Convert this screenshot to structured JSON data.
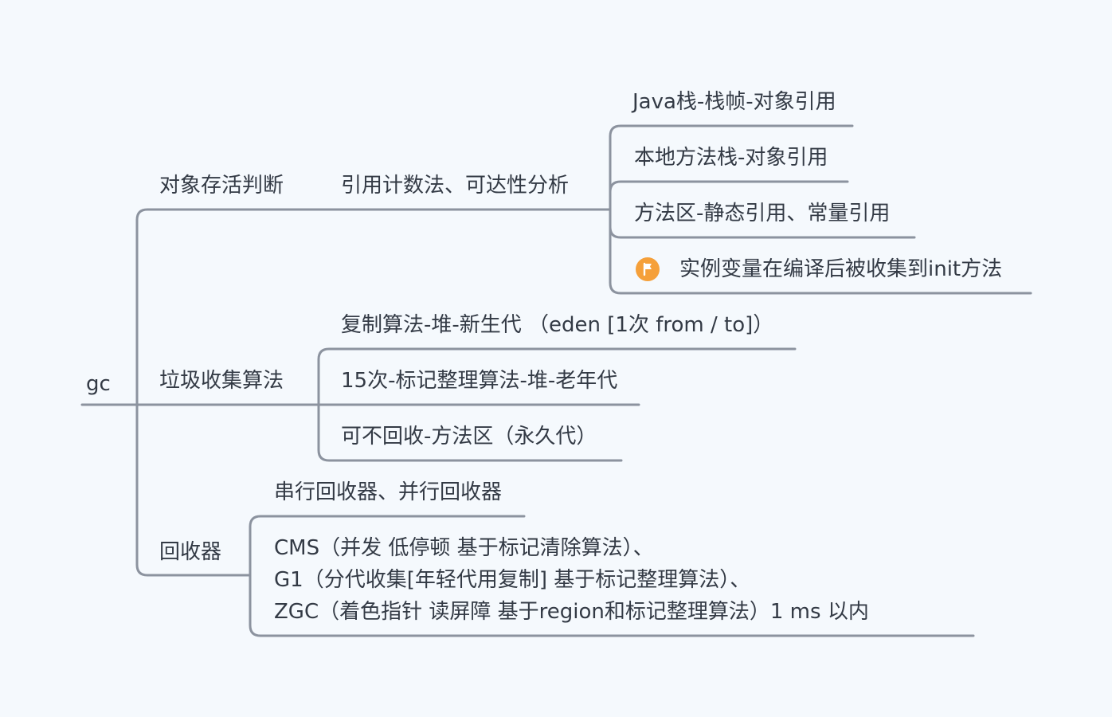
{
  "root": {
    "label": "gc"
  },
  "branches": [
    {
      "label": "对象存活判断",
      "children": [
        {
          "label": "引用计数法、可达性分析",
          "children": [
            {
              "label": "Java栈-栈帧-对象引用"
            },
            {
              "label": "本地方法栈-对象引用"
            },
            {
              "label": "方法区-静态引用、常量引用"
            },
            {
              "label": "实例变量在编译后被收集到init方法",
              "marker": "flag-icon",
              "marker_color": "#f5a03a"
            }
          ]
        }
      ]
    },
    {
      "label": "垃圾收集算法",
      "children": [
        {
          "label": "复制算法-堆-新生代 （eden [1次 from / to]）"
        },
        {
          "label": "15次-标记整理算法-堆-老年代"
        },
        {
          "label": "可不回收-方法区（永久代）"
        }
      ]
    },
    {
      "label": "回收器",
      "children": [
        {
          "label": "串行回收器、并行回收器"
        },
        {
          "lines": [
            "CMS（并发 低停顿 基于标记清除算法）、",
            "G1（分代收集[年轻代用复制] 基于标记整理算法）、",
            "ZGC（着色指针 读屏障 基于region和标记整理算法）1 ms 以内"
          ]
        }
      ]
    }
  ],
  "colors": {
    "background": "#f5f9fd",
    "connector": "#8c939f",
    "text": "#333a45",
    "flag": "#f5a03a"
  }
}
